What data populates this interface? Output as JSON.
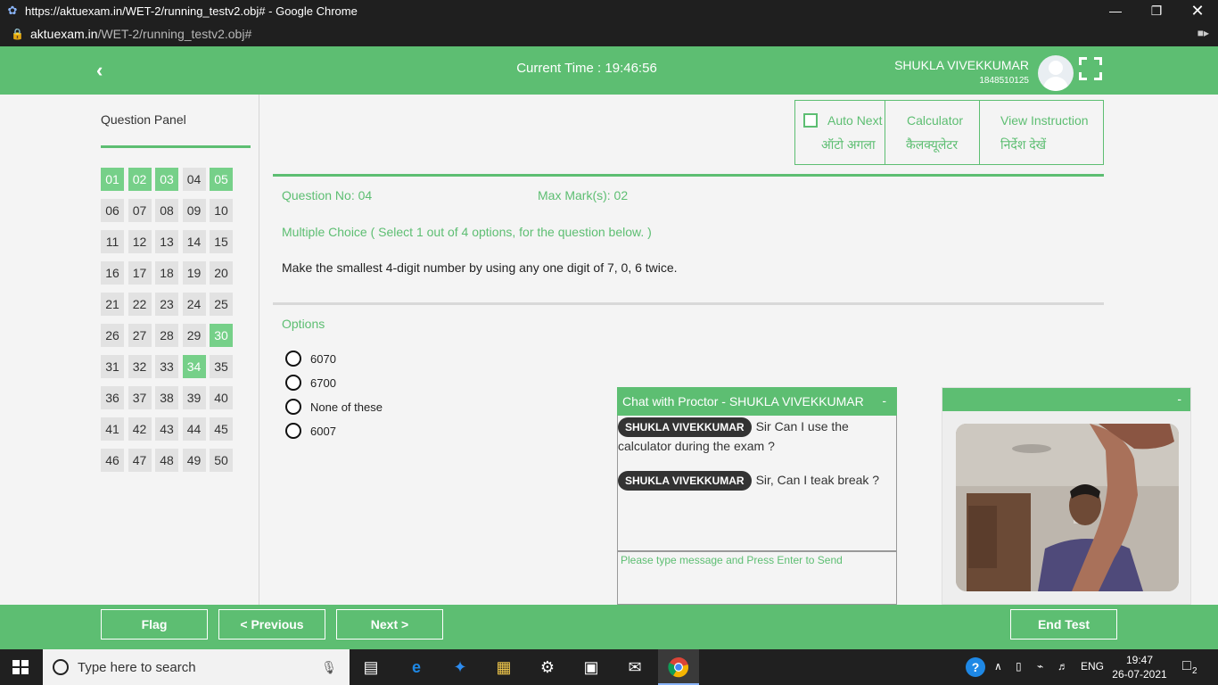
{
  "browser": {
    "window_title": "https://aktuexam.in/WET-2/running_testv2.obj# - Google Chrome",
    "url_host": "aktuexam.in",
    "url_path": "/WET-2/running_testv2.obj#"
  },
  "header": {
    "current_time": "Current Time : 19:46:56",
    "user_name": "SHUKLA VIVEKKUMAR",
    "user_id": "1848510125"
  },
  "panel": {
    "title": "Question Panel",
    "questions": [
      "01",
      "02",
      "03",
      "04",
      "05",
      "06",
      "07",
      "08",
      "09",
      "10",
      "11",
      "12",
      "13",
      "14",
      "15",
      "16",
      "17",
      "18",
      "19",
      "20",
      "21",
      "22",
      "23",
      "24",
      "25",
      "26",
      "27",
      "28",
      "29",
      "30",
      "31",
      "32",
      "33",
      "34",
      "35",
      "36",
      "37",
      "38",
      "39",
      "40",
      "41",
      "42",
      "43",
      "44",
      "45",
      "46",
      "47",
      "48",
      "49",
      "50"
    ],
    "answered": [
      "01",
      "02",
      "03",
      "05",
      "30",
      "34"
    ]
  },
  "tools": {
    "auto_next_en": "Auto Next",
    "auto_next_hi": "ऑटो अगला",
    "calculator_en": "Calculator",
    "calculator_hi": "कैलक्यूलेटर",
    "instruction_en": "View Instruction",
    "instruction_hi": "निर्देश देखें"
  },
  "question": {
    "number": "Question No: 04",
    "max_marks": "Max Mark(s): 02",
    "type": "Multiple Choice ( Select 1 out of 4 options, for the question below. )",
    "text": "Make the smallest 4-digit number by using any one digit of 7, 0, 6 twice.",
    "options_title": "Options",
    "options": [
      "6070",
      "6700",
      "None of these",
      "6007"
    ]
  },
  "chat": {
    "title": "Chat with Proctor - SHUKLA VIVEKKUMAR",
    "minimize": "-",
    "messages": [
      {
        "sender": "SHUKLA VIVEKKUMAR",
        "text": "Sir Can I use the calculator during the exam ?"
      },
      {
        "sender": "SHUKLA VIVEKKUMAR",
        "text": "Sir, Can I teak break ?"
      }
    ],
    "input_placeholder": "Please type message and Press Enter to Send"
  },
  "video": {
    "minimize": "-"
  },
  "footer": {
    "flag": "Flag",
    "previous": "< Previous",
    "next": "Next >",
    "end_test": "End Test"
  },
  "taskbar": {
    "search_placeholder": "Type here to search",
    "language": "ENG",
    "time": "19:47",
    "date": "26-07-2021",
    "notification_count": "2"
  },
  "colors": {
    "accent": "#5dbe72",
    "answered": "#76d089",
    "unanswered": "#e2e2e2"
  }
}
